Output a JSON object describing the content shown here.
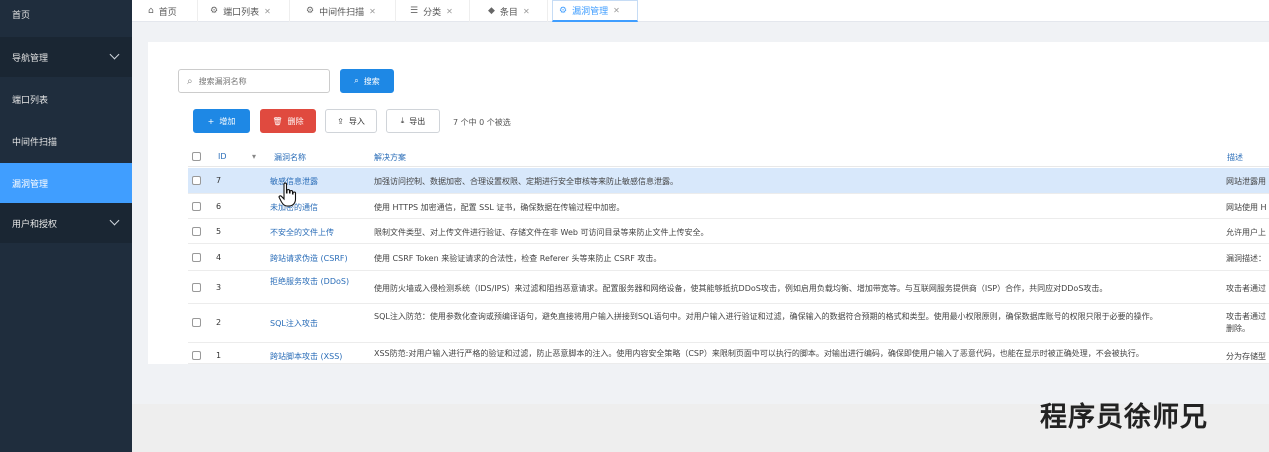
{
  "sidebar": {
    "items": [
      {
        "label": "首页"
      },
      {
        "label": "导航管理"
      },
      {
        "label": "端口列表"
      },
      {
        "label": "中间件扫描"
      },
      {
        "label": "漏洞管理"
      },
      {
        "label": "用户和授权"
      }
    ]
  },
  "tabs": [
    {
      "label": "首页",
      "icon": "home-icon"
    },
    {
      "label": "端口列表",
      "icon": "port-icon"
    },
    {
      "label": "中间件扫描",
      "icon": "scan-icon"
    },
    {
      "label": "分类",
      "icon": "list-icon"
    },
    {
      "label": "条目",
      "icon": "tag-icon"
    },
    {
      "label": "漏洞管理",
      "icon": "bug-icon"
    }
  ],
  "toolbar": {
    "search_placeholder": "搜索漏洞名称",
    "search_button": "搜索",
    "add_label": "增加",
    "delete_label": "删除",
    "import_label": "导入",
    "export_label": "导出",
    "selection_text": "7 个中 0 个被选"
  },
  "table": {
    "headers": {
      "id": "ID",
      "name": "漏洞名称",
      "solution": "解决方案",
      "desc": "描述"
    },
    "rows": [
      {
        "id": "7",
        "name": "敏感信息泄露",
        "solution": "加强访问控制、数据加密、合理设置权限、定期进行安全审核等来防止敏感信息泄露。",
        "desc": "网站泄露用"
      },
      {
        "id": "6",
        "name": "未加密的通信",
        "solution": "使用 HTTPS 加密通信，配置 SSL 证书，确保数据在传输过程中加密。",
        "desc": "网站使用 H"
      },
      {
        "id": "5",
        "name": "不安全的文件上传",
        "solution": "限制文件类型、对上传文件进行验证、存储文件在非 Web 可访问目录等来防止文件上传安全。",
        "desc": "允许用户上"
      },
      {
        "id": "4",
        "name": "跨站请求伪造 (CSRF)",
        "solution": "使用 CSRF Token 来验证请求的合法性，检查 Referer 头等来防止 CSRF 攻击。",
        "desc": "漏洞描述："
      },
      {
        "id": "3",
        "name": "拒绝服务攻击 (DDoS)",
        "solution": "使用防火墙或入侵检测系统（IDS/IPS）来过滤和阻挡恶意请求。配置服务器和网络设备，使其能够抵抗DDoS攻击，例如启用负载均衡、增加带宽等。与互联网服务提供商（ISP）合作，共同应对DDoS攻击。",
        "desc": "攻击者通过"
      },
      {
        "id": "2",
        "name": "SQL注入攻击",
        "solution": "SQL注入防范：使用参数化查询或预编译语句，避免直接将用户输入拼接到SQL语句中。对用户输入进行验证和过滤，确保输入的数据符合预期的格式和类型。使用最小权限原则，确保数据库账号的权限只限于必要的操作。",
        "desc": "攻击者通过 删除。"
      },
      {
        "id": "1",
        "name": "跨站脚本攻击 (XSS)",
        "solution": "XSS防范:对用户输入进行严格的验证和过滤，防止恶意脚本的注入。使用内容安全策略（CSP）来限制页面中可以执行的脚本。对输出进行编码，确保即使用户输入了恶意代码，也能在显示时被正确处理，不会被执行。",
        "desc": "分为存储型"
      }
    ]
  },
  "watermark": "程序员徐师兄"
}
